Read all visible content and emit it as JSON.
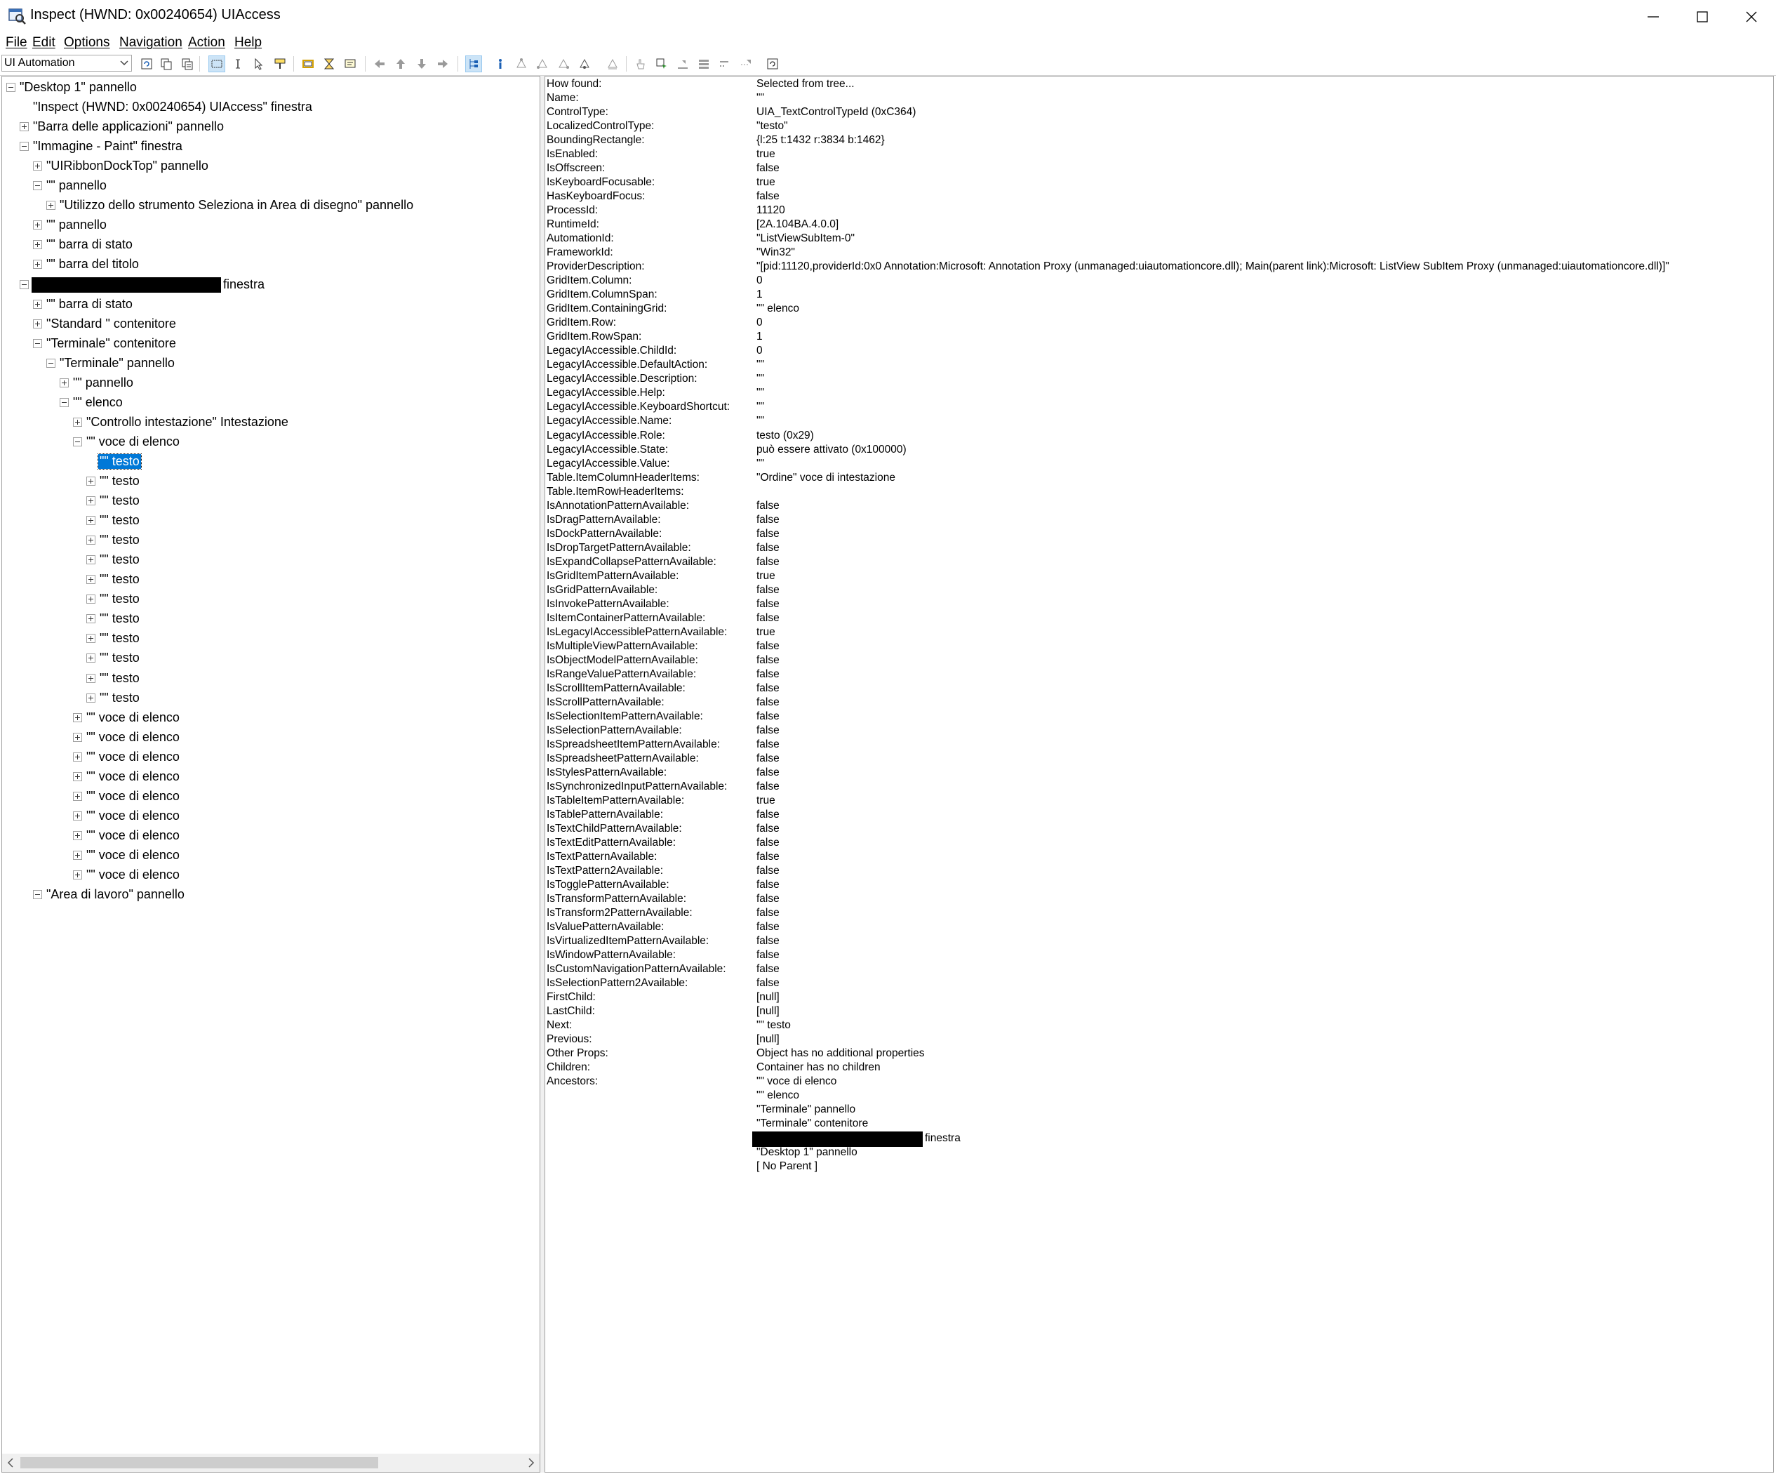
{
  "window": {
    "title": "Inspect  (HWND: 0x00240654) UIAccess"
  },
  "menu": [
    "File",
    "Edit",
    "Options",
    "Navigation",
    "Action",
    "Help"
  ],
  "toolbar": {
    "mode": "UI Automation"
  },
  "tree": {
    "nodes": [
      {
        "depth": 0,
        "toggle": "minus",
        "text": "\"Desktop 1\" pannello"
      },
      {
        "depth": 1,
        "toggle": "none",
        "text": "\"Inspect  (HWND: 0x00240654) UIAccess\" finestra"
      },
      {
        "depth": 1,
        "toggle": "plus",
        "text": "\"Barra delle applicazioni\" pannello"
      },
      {
        "depth": 1,
        "toggle": "minus",
        "text": "\"Immagine - Paint\" finestra"
      },
      {
        "depth": 2,
        "toggle": "plus",
        "text": "\"UIRibbonDockTop\" pannello"
      },
      {
        "depth": 2,
        "toggle": "minus",
        "text": "\"\" pannello"
      },
      {
        "depth": 3,
        "toggle": "plus",
        "text": "\"Utilizzo dello strumento Seleziona in Area di disegno\" pannello"
      },
      {
        "depth": 2,
        "toggle": "plus",
        "text": "\"\" pannello"
      },
      {
        "depth": 2,
        "toggle": "plus",
        "text": "\"\" barra di stato"
      },
      {
        "depth": 2,
        "toggle": "plus",
        "text": "\"\" barra del titolo"
      },
      {
        "depth": 1,
        "toggle": "minus",
        "text": "finestra",
        "redacted": true
      },
      {
        "depth": 2,
        "toggle": "plus",
        "text": "\"\" barra di stato"
      },
      {
        "depth": 2,
        "toggle": "plus",
        "text": "\"Standard \" contenitore"
      },
      {
        "depth": 2,
        "toggle": "minus",
        "text": "\"Terminale\" contenitore"
      },
      {
        "depth": 3,
        "toggle": "minus",
        "text": "\"Terminale\" pannello"
      },
      {
        "depth": 4,
        "toggle": "plus",
        "text": "\"\" pannello"
      },
      {
        "depth": 4,
        "toggle": "minus",
        "text": "\"\" elenco"
      },
      {
        "depth": 5,
        "toggle": "plus",
        "text": "\"Controllo intestazione\" Intestazione"
      },
      {
        "depth": 5,
        "toggle": "minus",
        "text": "\"\" voce di elenco"
      },
      {
        "depth": 6,
        "toggle": "none",
        "text": "\"\" testo",
        "selected": true
      },
      {
        "depth": 6,
        "toggle": "plus",
        "text": "\"\" testo"
      },
      {
        "depth": 6,
        "toggle": "plus",
        "text": "\"\" testo"
      },
      {
        "depth": 6,
        "toggle": "plus",
        "text": "\"\" testo"
      },
      {
        "depth": 6,
        "toggle": "plus",
        "text": "\"\" testo"
      },
      {
        "depth": 6,
        "toggle": "plus",
        "text": "\"\" testo"
      },
      {
        "depth": 6,
        "toggle": "plus",
        "text": "\"\" testo"
      },
      {
        "depth": 6,
        "toggle": "plus",
        "text": "\"\" testo"
      },
      {
        "depth": 6,
        "toggle": "plus",
        "text": "\"\" testo"
      },
      {
        "depth": 6,
        "toggle": "plus",
        "text": "\"\" testo"
      },
      {
        "depth": 6,
        "toggle": "plus",
        "text": "\"\" testo"
      },
      {
        "depth": 6,
        "toggle": "plus",
        "text": "\"\" testo"
      },
      {
        "depth": 6,
        "toggle": "plus",
        "text": "\"\" testo"
      },
      {
        "depth": 5,
        "toggle": "plus",
        "text": "\"\" voce di elenco"
      },
      {
        "depth": 5,
        "toggle": "plus",
        "text": "\"\" voce di elenco"
      },
      {
        "depth": 5,
        "toggle": "plus",
        "text": "\"\" voce di elenco"
      },
      {
        "depth": 5,
        "toggle": "plus",
        "text": "\"\" voce di elenco"
      },
      {
        "depth": 5,
        "toggle": "plus",
        "text": "\"\" voce di elenco"
      },
      {
        "depth": 5,
        "toggle": "plus",
        "text": "\"\" voce di elenco"
      },
      {
        "depth": 5,
        "toggle": "plus",
        "text": "\"\" voce di elenco"
      },
      {
        "depth": 5,
        "toggle": "plus",
        "text": "\"\" voce di elenco"
      },
      {
        "depth": 5,
        "toggle": "plus",
        "text": "\"\" voce di elenco"
      },
      {
        "depth": 2,
        "toggle": "minus",
        "text": "\"Area di lavoro\" pannello"
      }
    ]
  },
  "properties": [
    [
      "How found:",
      "Selected from tree..."
    ],
    [
      "Name:",
      "\"\""
    ],
    [
      "ControlType:",
      "UIA_TextControlTypeId (0xC364)"
    ],
    [
      "LocalizedControlType:",
      "\"testo\""
    ],
    [
      "BoundingRectangle:",
      "{l:25 t:1432 r:3834 b:1462}"
    ],
    [
      "IsEnabled:",
      "true"
    ],
    [
      "IsOffscreen:",
      "false"
    ],
    [
      "IsKeyboardFocusable:",
      "true"
    ],
    [
      "HasKeyboardFocus:",
      "false"
    ],
    [
      "ProcessId:",
      "11120"
    ],
    [
      "RuntimeId:",
      "[2A.104BA.4.0.0]"
    ],
    [
      "AutomationId:",
      "\"ListViewSubItem-0\""
    ],
    [
      "FrameworkId:",
      "\"Win32\""
    ],
    [
      "ProviderDescription:",
      "\"[pid:11120,providerId:0x0 Annotation:Microsoft: Annotation Proxy (unmanaged:uiautomationcore.dll); Main(parent link):Microsoft: ListView SubItem Proxy (unmanaged:uiautomationcore.dll)]\""
    ],
    [
      "GridItem.Column:",
      "0"
    ],
    [
      "GridItem.ColumnSpan:",
      "1"
    ],
    [
      "GridItem.ContainingGrid:",
      "\"\" elenco"
    ],
    [
      "GridItem.Row:",
      "0"
    ],
    [
      "GridItem.RowSpan:",
      "1"
    ],
    [
      "LegacyIAccessible.ChildId:",
      "0"
    ],
    [
      "LegacyIAccessible.DefaultAction:",
      "\"\""
    ],
    [
      "LegacyIAccessible.Description:",
      "\"\""
    ],
    [
      "LegacyIAccessible.Help:",
      "\"\""
    ],
    [
      "LegacyIAccessible.KeyboardShortcut:",
      "\"\""
    ],
    [
      "LegacyIAccessible.Name:",
      "\"\""
    ],
    [
      "LegacyIAccessible.Role:",
      "testo (0x29)"
    ],
    [
      "LegacyIAccessible.State:",
      "può essere attivato (0x100000)"
    ],
    [
      "LegacyIAccessible.Value:",
      "\"\""
    ],
    [
      "Table.ItemColumnHeaderItems:",
      "\"Ordine\" voce di intestazione"
    ],
    [
      "Table.ItemRowHeaderItems:",
      ""
    ],
    [
      "IsAnnotationPatternAvailable:",
      "false"
    ],
    [
      "IsDragPatternAvailable:",
      "false"
    ],
    [
      "IsDockPatternAvailable:",
      "false"
    ],
    [
      "IsDropTargetPatternAvailable:",
      "false"
    ],
    [
      "IsExpandCollapsePatternAvailable:",
      "false"
    ],
    [
      "IsGridItemPatternAvailable:",
      "true"
    ],
    [
      "IsGridPatternAvailable:",
      "false"
    ],
    [
      "IsInvokePatternAvailable:",
      "false"
    ],
    [
      "IsItemContainerPatternAvailable:",
      "false"
    ],
    [
      "IsLegacyIAccessiblePatternAvailable:",
      "true"
    ],
    [
      "IsMultipleViewPatternAvailable:",
      "false"
    ],
    [
      "IsObjectModelPatternAvailable:",
      "false"
    ],
    [
      "IsRangeValuePatternAvailable:",
      "false"
    ],
    [
      "IsScrollItemPatternAvailable:",
      "false"
    ],
    [
      "IsScrollPatternAvailable:",
      "false"
    ],
    [
      "IsSelectionItemPatternAvailable:",
      "false"
    ],
    [
      "IsSelectionPatternAvailable:",
      "false"
    ],
    [
      "IsSpreadsheetItemPatternAvailable:",
      "false"
    ],
    [
      "IsSpreadsheetPatternAvailable:",
      "false"
    ],
    [
      "IsStylesPatternAvailable:",
      "false"
    ],
    [
      "IsSynchronizedInputPatternAvailable:",
      "false"
    ],
    [
      "IsTableItemPatternAvailable:",
      "true"
    ],
    [
      "IsTablePatternAvailable:",
      "false"
    ],
    [
      "IsTextChildPatternAvailable:",
      "false"
    ],
    [
      "IsTextEditPatternAvailable:",
      "false"
    ],
    [
      "IsTextPatternAvailable:",
      "false"
    ],
    [
      "IsTextPattern2Available:",
      "false"
    ],
    [
      "IsTogglePatternAvailable:",
      "false"
    ],
    [
      "IsTransformPatternAvailable:",
      "false"
    ],
    [
      "IsTransform2PatternAvailable:",
      "false"
    ],
    [
      "IsValuePatternAvailable:",
      "false"
    ],
    [
      "IsVirtualizedItemPatternAvailable:",
      "false"
    ],
    [
      "IsWindowPatternAvailable:",
      "false"
    ],
    [
      "IsCustomNavigationPatternAvailable:",
      "false"
    ],
    [
      "IsSelectionPattern2Available:",
      "false"
    ],
    [
      "FirstChild:",
      "[null]"
    ],
    [
      "LastChild:",
      "[null]"
    ],
    [
      "Next:",
      "\"\" testo"
    ],
    [
      "Previous:",
      "[null]"
    ],
    [
      "Other Props:",
      "Object has no additional properties"
    ],
    [
      "Children:",
      "Container has no children"
    ],
    [
      "Ancestors:",
      "\"\" voce di elenco"
    ]
  ],
  "ancestors_more": [
    {
      "text": "\"\" elenco"
    },
    {
      "text": "\"Terminale\" pannello"
    },
    {
      "text": "\"Terminale\" contenitore"
    },
    {
      "text": "finestra",
      "redacted": true
    },
    {
      "text": "\"Desktop 1\" pannello"
    },
    {
      "text": "[ No Parent ]"
    }
  ]
}
